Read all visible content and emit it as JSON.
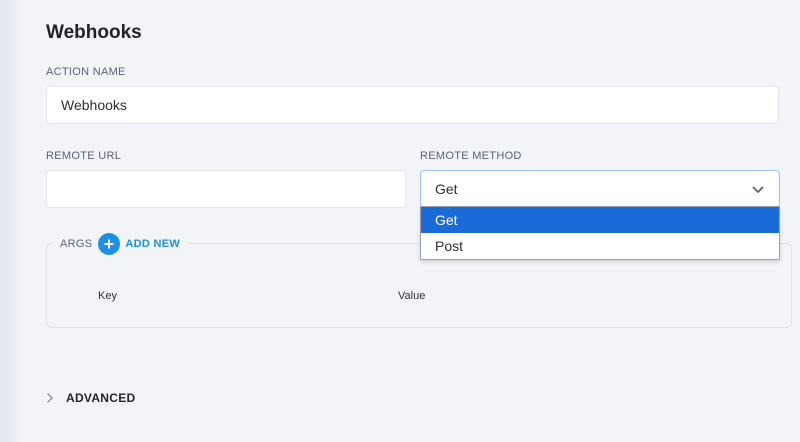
{
  "form": {
    "title": "Webhooks",
    "action_name": {
      "label": "ACTION NAME",
      "value": "Webhooks"
    },
    "remote_url": {
      "label": "REMOTE URL",
      "value": ""
    },
    "remote_method": {
      "label": "REMOTE METHOD",
      "selected": "Get",
      "options": [
        "Get",
        "Post"
      ]
    },
    "args": {
      "label": "ARGS",
      "add_label": "ADD NEW",
      "columns": [
        "Key",
        "Value"
      ]
    },
    "advanced_label": "ADVANCED"
  },
  "colors": {
    "accent": "#1e8fe6",
    "selected_option": "#1a6ad8"
  }
}
